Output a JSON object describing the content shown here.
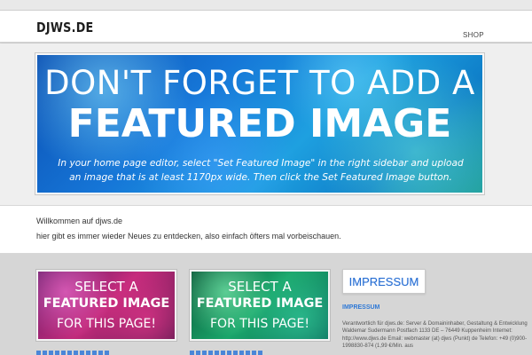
{
  "header": {
    "logo": "DJWS.DE",
    "nav": {
      "shop": "SHOP"
    }
  },
  "hero": {
    "line1": "DON'T FORGET TO ADD A",
    "line2": "FEATURED IMAGE",
    "subtitle": "In your home page editor, select \"Set Featured Image\" in the right sidebar and upload an image that is at least 1170px wide. Then click the Set Featured Image button."
  },
  "welcome": {
    "title": "Willkommen auf djws.de",
    "text": "hier gibt es immer wieder Neues zu entdecken, also einfach öfters mal vorbeischauen."
  },
  "cards": [
    {
      "line1": "SELECT A",
      "line2": "FEATURED IMAGE",
      "line3": "FOR THIS PAGE!"
    },
    {
      "line1": "SELECT A",
      "line2": "FEATURED IMAGE",
      "line3": "FOR THIS PAGE!"
    }
  ],
  "impressum": {
    "box_label": "IMPRESSUM",
    "title": "IMPRESSUM",
    "text": "Verantwortlich für djws.de: Server & Domaininhaber, Gestaltung & Entwicklung Waldemar Sudermann Postfach 1133 DE – 76449 Kuppenheim Internet: http://www.djws.de Email: webmaster (at) djws (Punkt) de Telefon: +49 (0)900-1998830-874 (1,99 €/Min. aus"
  },
  "colors": {
    "link_blue": "#2f79d6",
    "background": "#d6d6d6"
  }
}
